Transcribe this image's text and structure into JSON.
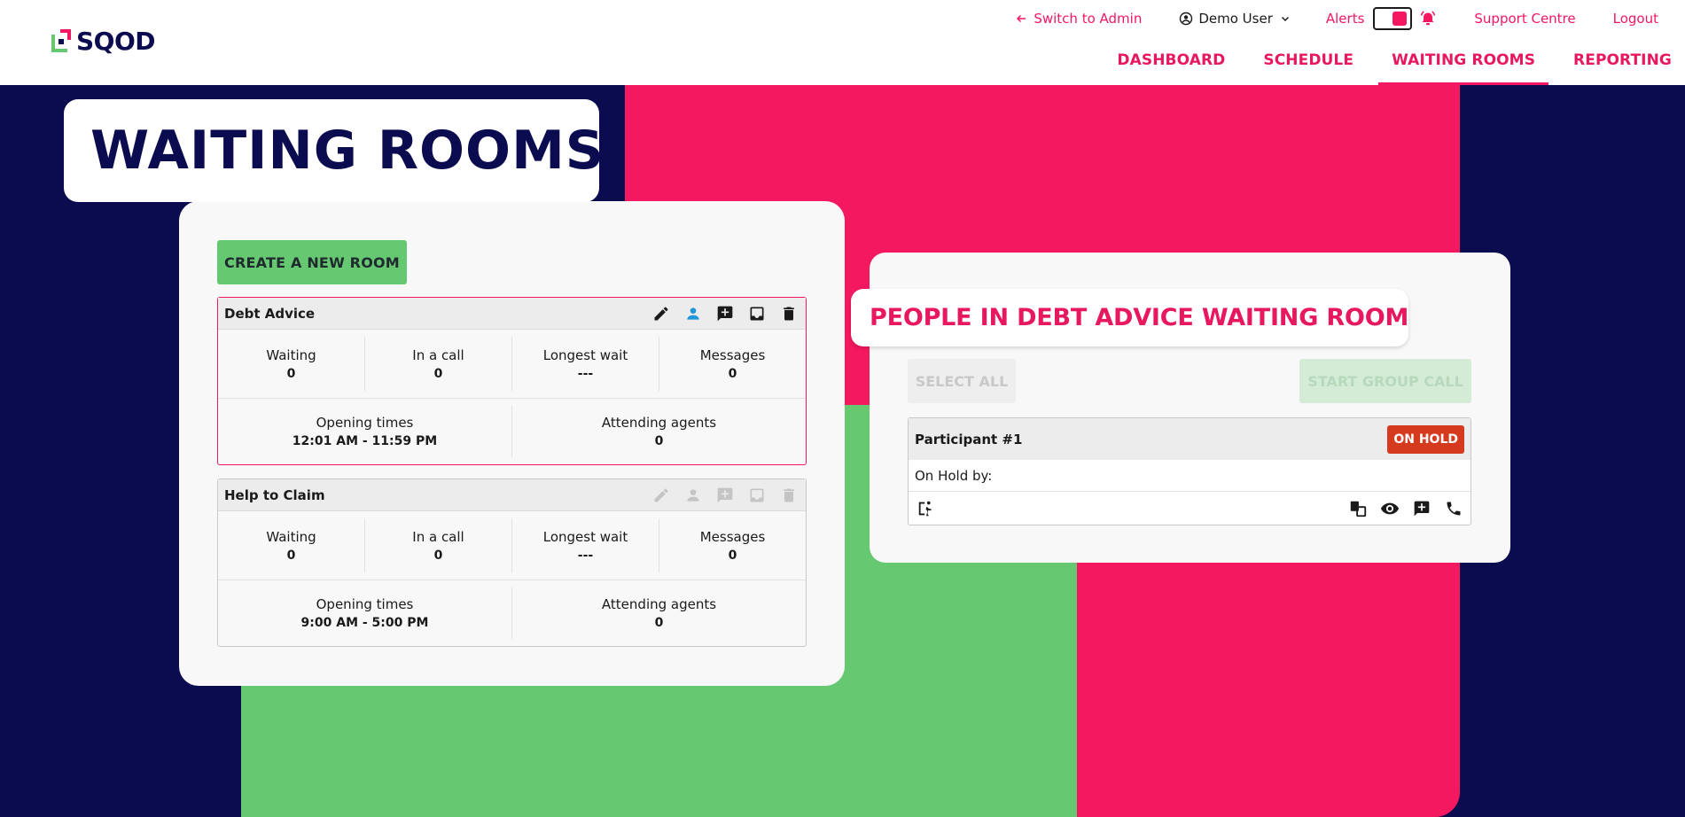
{
  "brand": {
    "name": "SQOD"
  },
  "topbar": {
    "switch_label": "Switch to Admin",
    "user_label": "Demo User",
    "alerts_label": "Alerts",
    "support_label": "Support Centre",
    "logout_label": "Logout"
  },
  "nav": {
    "items": [
      {
        "label": "DASHBOARD",
        "active": false
      },
      {
        "label": "SCHEDULE",
        "active": false
      },
      {
        "label": "WAITING ROOMS",
        "active": true
      },
      {
        "label": "REPORTING",
        "active": false
      }
    ]
  },
  "page": {
    "title": "WAITING ROOMS"
  },
  "rooms_panel": {
    "create_label": "CREATE A NEW ROOM",
    "rooms": [
      {
        "name": "Debt Advice",
        "selected": true,
        "stats": [
          {
            "label": "Waiting",
            "value": "0"
          },
          {
            "label": "In a call",
            "value": "0"
          },
          {
            "label": "Longest wait",
            "value": "---"
          },
          {
            "label": "Messages",
            "value": "0"
          }
        ],
        "info": [
          {
            "label": "Opening times",
            "value": "12:01 AM - 11:59 PM"
          },
          {
            "label": "Attending agents",
            "value": "0"
          }
        ]
      },
      {
        "name": "Help to Claim",
        "selected": false,
        "stats": [
          {
            "label": "Waiting",
            "value": "0"
          },
          {
            "label": "In a call",
            "value": "0"
          },
          {
            "label": "Longest wait",
            "value": "---"
          },
          {
            "label": "Messages",
            "value": "0"
          }
        ],
        "info": [
          {
            "label": "Opening times",
            "value": "9:00 AM - 5:00 PM"
          },
          {
            "label": "Attending agents",
            "value": "0"
          }
        ]
      }
    ]
  },
  "people_panel": {
    "title": "PEOPLE IN DEBT ADVICE WAITING ROOM",
    "select_all_label": "SELECT ALL",
    "group_call_label": "START GROUP CALL",
    "participants": [
      {
        "name": "Participant #1",
        "status": "ON HOLD",
        "on_hold_by_label": "On Hold by:"
      }
    ]
  },
  "colors": {
    "navy": "#0b0c4f",
    "pink": "#f3185f",
    "green": "#66c871",
    "hold_red": "#d63a1e",
    "active_icon_blue": "#2196d9"
  }
}
